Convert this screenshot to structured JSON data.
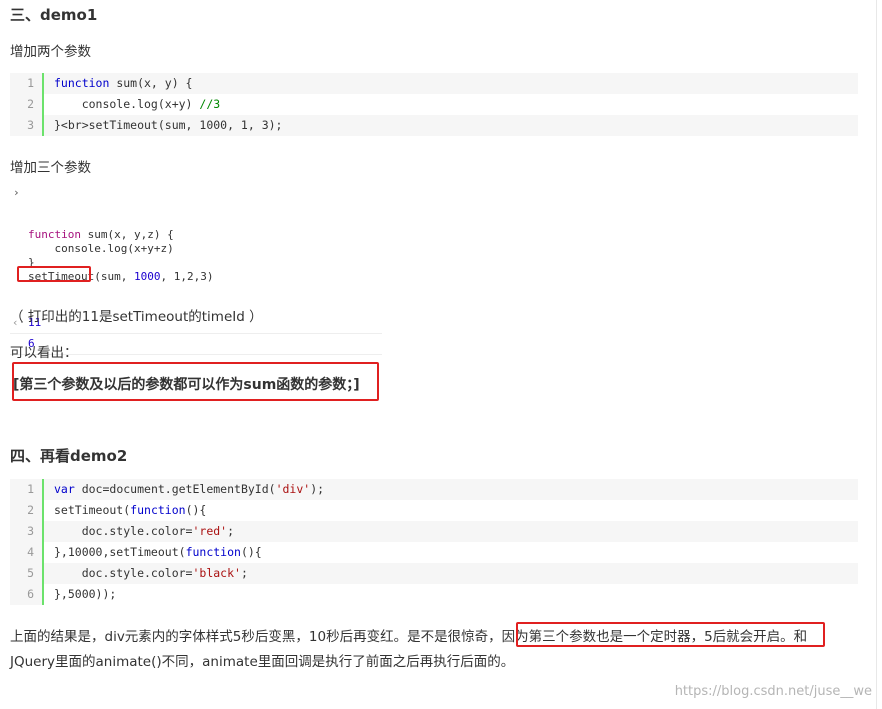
{
  "section3": {
    "title": "三、demo1",
    "add_two_params": "增加两个参数",
    "code1": [
      {
        "num": "1",
        "parts": [
          {
            "t": "function",
            "c": "kw"
          },
          {
            "t": " sum(x, y) {",
            "c": ""
          }
        ]
      },
      {
        "num": "2",
        "parts": [
          {
            "t": "    console.log(x+y) ",
            "c": ""
          },
          {
            "t": "//3",
            "c": "cm"
          }
        ]
      },
      {
        "num": "3",
        "parts": [
          {
            "t": "}<br>setTimeout(sum, 1000, 1, 3);",
            "c": ""
          }
        ]
      }
    ],
    "add_three_params": "增加三个参数",
    "console": {
      "input_lines": [
        [
          {
            "t": "function",
            "c": "con-kw"
          },
          {
            "t": " sum(x, y,z) {",
            "c": ""
          }
        ],
        [
          {
            "t": "    console.log(x+y+z)",
            "c": ""
          }
        ],
        [
          {
            "t": "}",
            "c": ""
          }
        ],
        [
          {
            "t": "setTimeout(sum, ",
            "c": ""
          },
          {
            "t": "1000",
            "c": "con-num"
          },
          {
            "t": ", 1,2,3)",
            "c": ""
          }
        ]
      ],
      "output_return": "11",
      "output_log": "6"
    },
    "note_timeid": "（ 打印出的11是setTimeout的timeId ）",
    "can_see": "可以看出：",
    "conclusion": "[第三个参数及以后的参数都可以作为sum函数的参数；]"
  },
  "section4": {
    "title": "四、再看demo2",
    "code2": [
      {
        "num": "1",
        "parts": [
          {
            "t": "var",
            "c": "kw"
          },
          {
            "t": " doc=document.getElementById(",
            "c": ""
          },
          {
            "t": "'div'",
            "c": "st"
          },
          {
            "t": ");",
            "c": ""
          }
        ]
      },
      {
        "num": "2",
        "parts": [
          {
            "t": "setTimeout(",
            "c": ""
          },
          {
            "t": "function",
            "c": "kw"
          },
          {
            "t": "(){",
            "c": ""
          }
        ]
      },
      {
        "num": "3",
        "parts": [
          {
            "t": "    doc.style.color=",
            "c": ""
          },
          {
            "t": "'red'",
            "c": "st"
          },
          {
            "t": ";",
            "c": ""
          }
        ]
      },
      {
        "num": "4",
        "parts": [
          {
            "t": "},10000,setTimeout(",
            "c": ""
          },
          {
            "t": "function",
            "c": "kw"
          },
          {
            "t": "(){",
            "c": ""
          }
        ]
      },
      {
        "num": "5",
        "parts": [
          {
            "t": "    doc.style.color=",
            "c": ""
          },
          {
            "t": "'black'",
            "c": "st"
          },
          {
            "t": ";",
            "c": ""
          }
        ]
      },
      {
        "num": "6",
        "parts": [
          {
            "t": "},5000));",
            "c": ""
          }
        ]
      }
    ],
    "result_line1": "上面的结果是，div元素内的字体样式5秒后变黑，10秒后再变红。是不是很惊奇，因为第三个参数也是一个定时器，5后就会开启。和",
    "result_line2": "JQuery里面的animate()不同，animate里面回调是执行了前面之后再执行后面的。"
  },
  "watermark": "https://blog.csdn.net/juse__we",
  "colors": {
    "highlight_border": "#e02020",
    "line_gutter": "#6ce26c",
    "keyword": "#0000cc",
    "string": "#aa1111",
    "comment": "#008800"
  }
}
